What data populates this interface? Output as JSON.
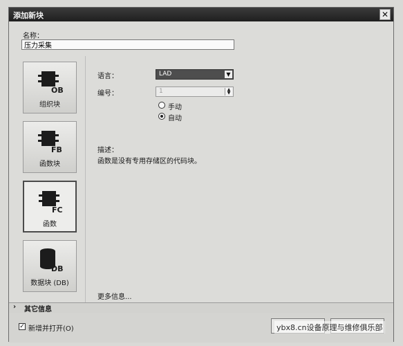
{
  "dialog": {
    "title": "添加新块"
  },
  "name": {
    "label": "名称：",
    "value": "压力采集"
  },
  "blocks": [
    {
      "label": "组织块",
      "code": "OB"
    },
    {
      "label": "函数块",
      "code": "FB"
    },
    {
      "label": "函数",
      "code": "FC"
    },
    {
      "label": "数据块 (DB)",
      "code": "DB"
    }
  ],
  "selected_block": "函数",
  "language": {
    "label": "语言：",
    "value": "LAD"
  },
  "number": {
    "label": "编号：",
    "value": "1"
  },
  "numbering_mode": {
    "manual": "手动",
    "auto": "自动",
    "selected": "自动"
  },
  "description": {
    "label": "描述：",
    "text": "函数是没有专用存储区的代码块。"
  },
  "more_info": "更多信息...",
  "other_info": {
    "label": "其它信息"
  },
  "footer": {
    "open_checkbox_label": "新增并打开(O)",
    "open_checked": true,
    "watermark": "ybx8.cn设备原理与维修俱乐部"
  }
}
